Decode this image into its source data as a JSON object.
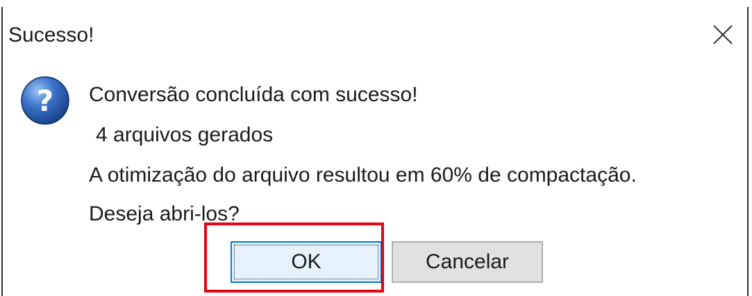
{
  "dialog": {
    "title": "Sucesso!",
    "close_symbol": "✕",
    "icon": "question-icon",
    "icon_glyph": "?",
    "messages": [
      "Conversão concluída com sucesso!",
      "4 arquivos gerados",
      "A otimização do arquivo resultou em 60% de compactação.",
      "Deseja abri-los?"
    ],
    "buttons": {
      "ok_label": "OK",
      "cancel_label": "Cancelar"
    }
  },
  "colors": {
    "highlight": "#e8000b",
    "focus_border": "#0078d7",
    "icon_blue": "#2a5db0"
  }
}
